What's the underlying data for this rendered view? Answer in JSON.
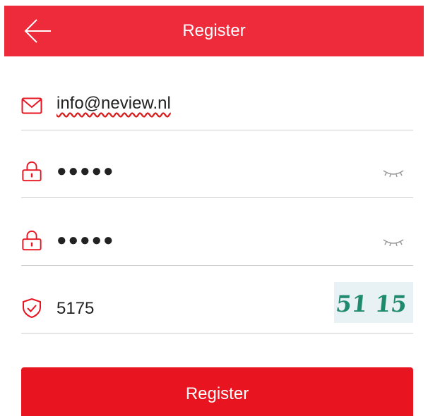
{
  "header": {
    "title": "Register",
    "back_icon": "arrow-left-icon",
    "background_color": "#ee2b3b"
  },
  "form": {
    "email": {
      "icon": "mail-icon",
      "value": "info@neview.nl"
    },
    "password": {
      "icon": "lock-icon",
      "value": "●●●●●",
      "toggle_icon": "eye-closed-icon"
    },
    "confirm_password": {
      "icon": "lock-icon",
      "value": "●●●●●",
      "toggle_icon": "eye-closed-icon"
    },
    "captcha": {
      "icon": "shield-check-icon",
      "value": "5175",
      "image_text": "51 15"
    }
  },
  "register_button": {
    "label": "Register",
    "background_color": "#e8141f"
  },
  "accent_color": "#e8141f"
}
